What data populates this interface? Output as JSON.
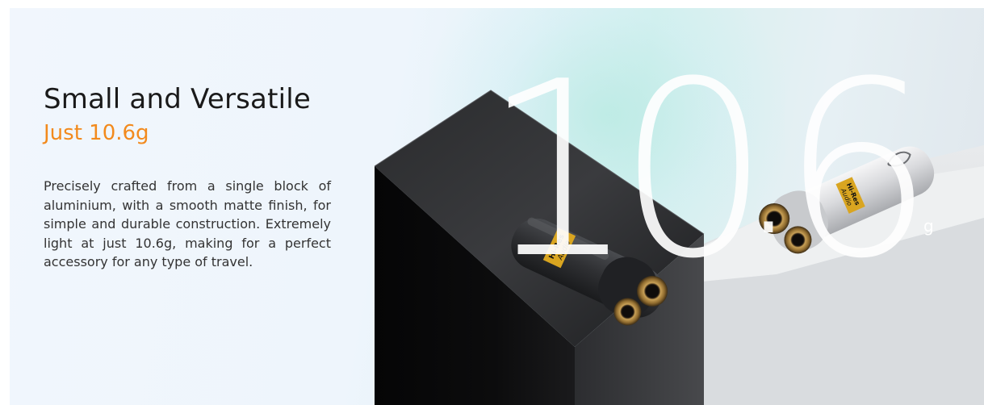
{
  "hero": {
    "headline": "Small and Versatile",
    "subheadline": "Just 10.6g",
    "description": "Precisely crafted from a single block of aluminium, with a smooth matte finish, for simple and durable construction. Extremely light at just 10.6g, making for a perfect accessory for any type of travel.",
    "accent_color": "#f28a1d"
  },
  "weight_graphic": {
    "digits": [
      "1",
      "0",
      ".",
      "6"
    ],
    "unit": "g"
  },
  "products": {
    "dark_dongle": {
      "badge_top": "Hi-Res",
      "badge_bottom": "Audio",
      "finish": "black"
    },
    "silver_dongle": {
      "badge_top": "Hi-Res",
      "badge_bottom": "Audio",
      "finish": "silver"
    }
  }
}
